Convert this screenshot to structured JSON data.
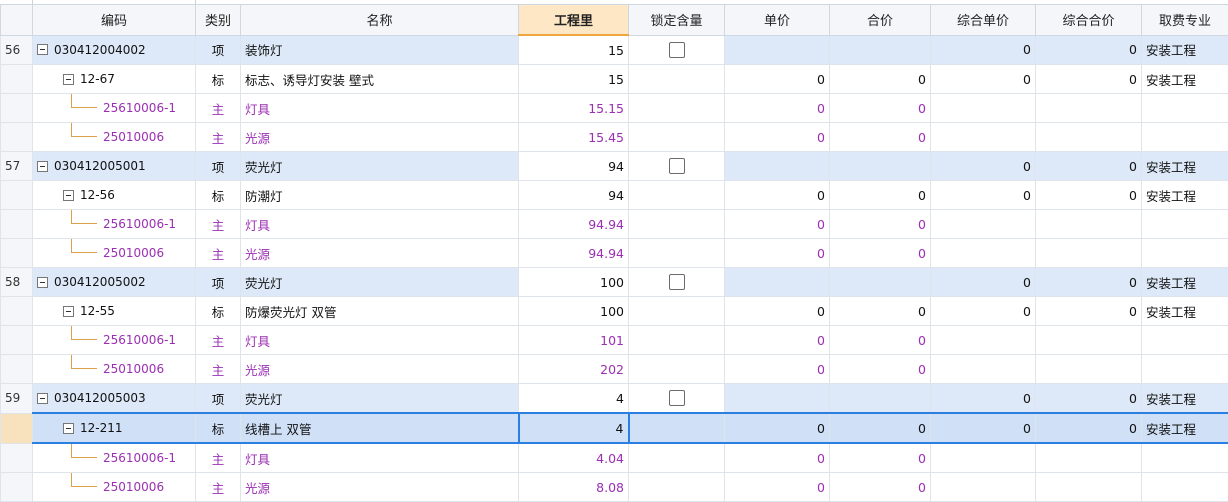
{
  "headers": [
    "",
    "编码",
    "类别",
    "名称",
    "工程里",
    "锁定含量",
    "单价",
    "合价",
    "综合单价",
    "综合合价",
    "取费专业"
  ],
  "rows": [
    {
      "no": "56",
      "kind": "item",
      "code": "030412004002",
      "type": "项",
      "name": "装饰灯",
      "qty": "15",
      "price": "",
      "total": "",
      "cprice": "0",
      "ctotal": "0",
      "spec": "安装工程",
      "lock": true
    },
    {
      "no": "",
      "kind": "std",
      "code": "12-67",
      "type": "标",
      "name": "标志、诱导灯安装 壁式",
      "qty": "15",
      "price": "0",
      "total": "0",
      "cprice": "0",
      "ctotal": "0",
      "spec": "安装工程",
      "lock": false
    },
    {
      "no": "",
      "kind": "main",
      "code": "25610006-1",
      "type": "主",
      "name": "灯具",
      "qty": "15.15",
      "price": "0",
      "total": "0",
      "cprice": "",
      "ctotal": "",
      "spec": "",
      "lock": false
    },
    {
      "no": "",
      "kind": "main",
      "code": "25010006",
      "type": "主",
      "name": "光源",
      "qty": "15.45",
      "price": "0",
      "total": "0",
      "cprice": "",
      "ctotal": "",
      "spec": "",
      "lock": false
    },
    {
      "no": "57",
      "kind": "item",
      "code": "030412005001",
      "type": "项",
      "name": "荧光灯",
      "qty": "94",
      "price": "",
      "total": "",
      "cprice": "0",
      "ctotal": "0",
      "spec": "安装工程",
      "lock": true
    },
    {
      "no": "",
      "kind": "std",
      "code": "12-56",
      "type": "标",
      "name": "防潮灯",
      "qty": "94",
      "price": "0",
      "total": "0",
      "cprice": "0",
      "ctotal": "0",
      "spec": "安装工程",
      "lock": false
    },
    {
      "no": "",
      "kind": "main",
      "code": "25610006-1",
      "type": "主",
      "name": "灯具",
      "qty": "94.94",
      "price": "0",
      "total": "0",
      "cprice": "",
      "ctotal": "",
      "spec": "",
      "lock": false
    },
    {
      "no": "",
      "kind": "main",
      "code": "25010006",
      "type": "主",
      "name": "光源",
      "qty": "94.94",
      "price": "0",
      "total": "0",
      "cprice": "",
      "ctotal": "",
      "spec": "",
      "lock": false
    },
    {
      "no": "58",
      "kind": "item",
      "code": "030412005002",
      "type": "项",
      "name": "荧光灯",
      "qty": "100",
      "price": "",
      "total": "",
      "cprice": "0",
      "ctotal": "0",
      "spec": "安装工程",
      "lock": true
    },
    {
      "no": "",
      "kind": "std",
      "code": "12-55",
      "type": "标",
      "name": "防爆荧光灯 双管",
      "qty": "100",
      "price": "0",
      "total": "0",
      "cprice": "0",
      "ctotal": "0",
      "spec": "安装工程",
      "lock": false
    },
    {
      "no": "",
      "kind": "main",
      "code": "25610006-1",
      "type": "主",
      "name": "灯具",
      "qty": "101",
      "price": "0",
      "total": "0",
      "cprice": "",
      "ctotal": "",
      "spec": "",
      "lock": false
    },
    {
      "no": "",
      "kind": "main",
      "code": "25010006",
      "type": "主",
      "name": "光源",
      "qty": "202",
      "price": "0",
      "total": "0",
      "cprice": "",
      "ctotal": "",
      "spec": "",
      "lock": false
    },
    {
      "no": "59",
      "kind": "item",
      "code": "030412005003",
      "type": "项",
      "name": "荧光灯",
      "qty": "4",
      "price": "",
      "total": "",
      "cprice": "0",
      "ctotal": "0",
      "spec": "安装工程",
      "lock": true
    },
    {
      "no": "",
      "kind": "std",
      "code": "12-211",
      "type": "标",
      "name": "线槽上 双管",
      "qty": "4",
      "price": "0",
      "total": "0",
      "cprice": "0",
      "ctotal": "0",
      "spec": "安装工程",
      "lock": false,
      "selected": true
    },
    {
      "no": "",
      "kind": "main",
      "code": "25610006-1",
      "type": "主",
      "name": "灯具",
      "qty": "4.04",
      "price": "0",
      "total": "0",
      "cprice": "",
      "ctotal": "",
      "spec": "",
      "lock": false
    },
    {
      "no": "",
      "kind": "main",
      "code": "25010006",
      "type": "主",
      "name": "光源",
      "qty": "8.08",
      "price": "0",
      "total": "0",
      "cprice": "",
      "ctotal": "",
      "spec": "",
      "lock": false
    }
  ]
}
